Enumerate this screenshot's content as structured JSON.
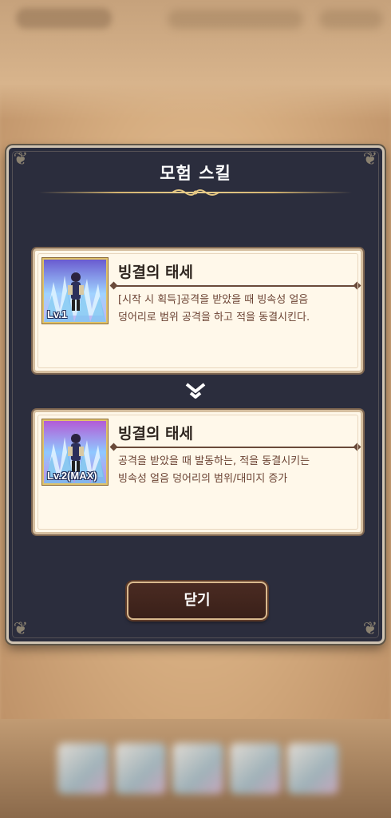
{
  "modal": {
    "title": "모험 스킬",
    "close_label": "닫기"
  },
  "skills": [
    {
      "level": "Lv.1",
      "name": "빙결의 태세",
      "description": "[시작 시 획득]공격을 받았을 때 빙속성 얼음\n덩어리로 범위 공격을 하고 적을 동결시킨다."
    },
    {
      "level": "Lv.2(MAX)",
      "name": "빙결의 태세",
      "description": "공격을 받았을 때 발동하는, 적을 동결시키는\n빙속성 얼음 덩어리의 범위/대미지 증가"
    }
  ],
  "icons": {
    "transition": "double-chevron-down-icon",
    "corner": "flourish-icon"
  },
  "colors": {
    "modal_bg": "#2b2d3d",
    "card_bg": "#fff8ea",
    "accent_gold": "#d2b270",
    "desc_text": "#6b4233",
    "button_bg": "#3a2019"
  }
}
